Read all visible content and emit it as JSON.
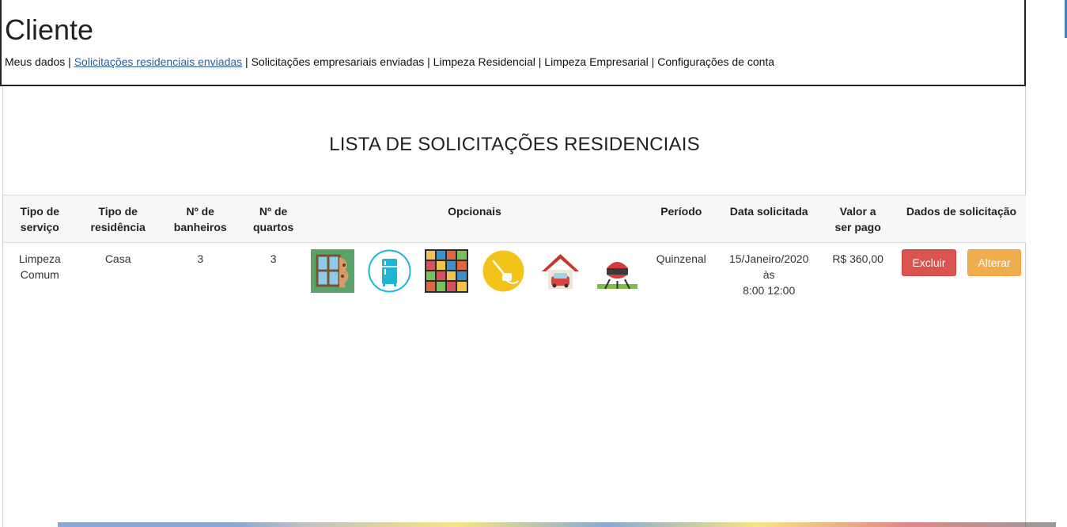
{
  "header": {
    "title": "Cliente",
    "nav": [
      {
        "label": "Meus dados",
        "active": false
      },
      {
        "label": "Solicitações residenciais enviadas",
        "active": true
      },
      {
        "label": "Solicitações empresariais enviadas",
        "active": false
      },
      {
        "label": "Limpeza Residencial",
        "active": false
      },
      {
        "label": "Limpeza Empresarial",
        "active": false
      },
      {
        "label": "Configurações de conta",
        "active": false
      }
    ],
    "separator": "|"
  },
  "main": {
    "title": "LISTA DE SOLICITAÇÕES RESIDENCIAIS",
    "table": {
      "headers": {
        "tipo_servico_1": "Tipo de",
        "tipo_servico_2": "serviço",
        "tipo_residencia_1": "Tipo de",
        "tipo_residencia_2": "residência",
        "banheiros_1": "Nº de",
        "banheiros_2": "banheiros",
        "quartos_1": "Nº de",
        "quartos_2": "quartos",
        "opcionais": "Opcionais",
        "periodo": "Período",
        "data": "Data solicitada",
        "valor_1": "Valor a",
        "valor_2": "ser pago",
        "dados": "Dados de solicitação"
      },
      "rows": [
        {
          "tipo_servico_1": "Limpeza",
          "tipo_servico_2": "Comum",
          "tipo_residencia": "Casa",
          "banheiros": "3",
          "quartos": "3",
          "opcionais_icons": [
            "window-cleaning-icon",
            "fridge-icon",
            "kitchen-cabinets-icon",
            "vacuum-icon",
            "garage-icon",
            "barbecue-icon"
          ],
          "periodo": "Quinzenal",
          "data_1": "15/Janeiro/2020 às",
          "data_2": "8:00 12:00",
          "valor": "R$ 360,00",
          "excluir_label": "Excluir",
          "alterar_label": "Alterar"
        }
      ]
    }
  },
  "colors": {
    "danger": "#d9534f",
    "warning": "#f0ad4e",
    "link_active": "#2a5d9f"
  }
}
